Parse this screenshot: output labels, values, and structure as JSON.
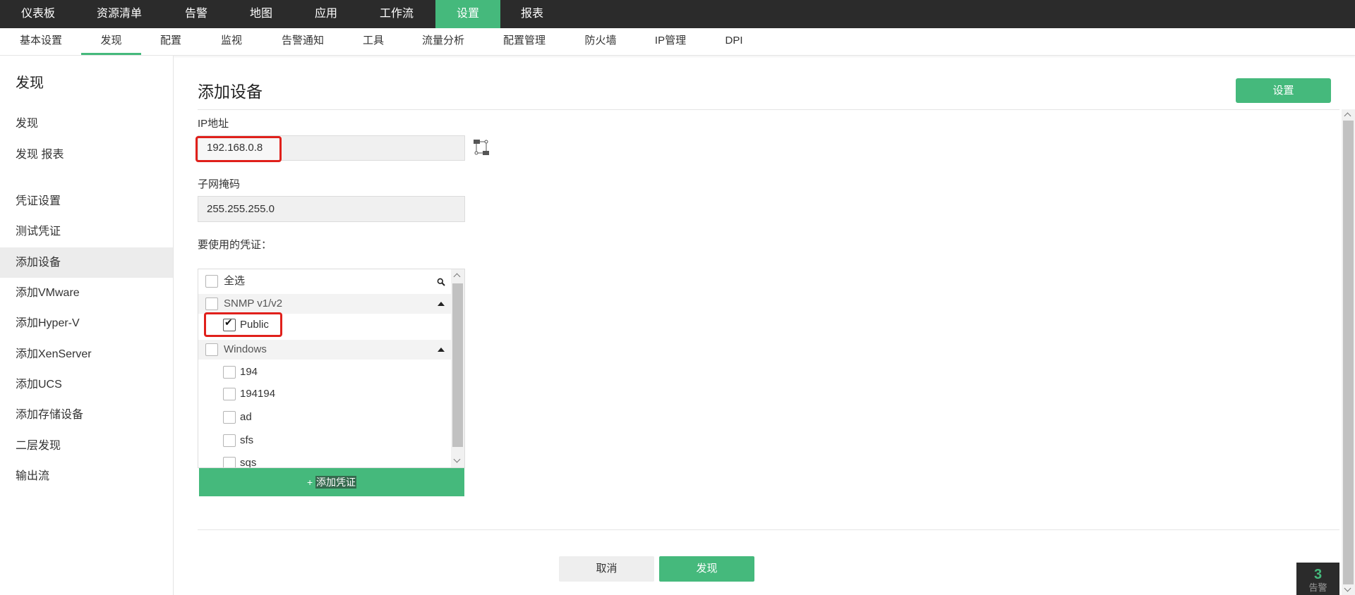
{
  "colors": {
    "accent": "#45b97c",
    "nav_bg": "#2b2b2b",
    "annotation_red": "#e0201b"
  },
  "icons": [
    "network-topology-icon",
    "search-icon",
    "caret-up-icon",
    "checkmark-icon",
    "chevron-up-icon",
    "chevron-down-icon"
  ],
  "top_nav": {
    "items": [
      {
        "label": "仪表板"
      },
      {
        "label": "资源清单"
      },
      {
        "label": "告警"
      },
      {
        "label": "地图"
      },
      {
        "label": "应用"
      },
      {
        "label": "工作流"
      },
      {
        "label": "设置",
        "active": true
      },
      {
        "label": "报表"
      }
    ]
  },
  "sub_nav": {
    "items": [
      {
        "label": "基本设置"
      },
      {
        "label": "发现",
        "active": true
      },
      {
        "label": "配置"
      },
      {
        "label": "监视"
      },
      {
        "label": "告警通知"
      },
      {
        "label": "工具"
      },
      {
        "label": "流量分析"
      },
      {
        "label": "配置管理"
      },
      {
        "label": "防火墙"
      },
      {
        "label": "IP管理"
      },
      {
        "label": "DPI"
      }
    ]
  },
  "sidebar": {
    "title": "发现",
    "items": [
      {
        "label": "发现"
      },
      {
        "label": "发现 报表"
      },
      {
        "label": "凭证设置"
      },
      {
        "label": "测试凭证"
      },
      {
        "label": "添加设备",
        "active": true
      },
      {
        "label": "添加VMware"
      },
      {
        "label": "添加Hyper-V"
      },
      {
        "label": "添加XenServer"
      },
      {
        "label": "添加UCS"
      },
      {
        "label": "添加存储设备"
      },
      {
        "label": "二层发现"
      },
      {
        "label": "输出流"
      }
    ]
  },
  "main": {
    "title": "添加设备",
    "settings_button": "设置",
    "ip_label": "IP地址",
    "ip_value": "192.168.0.8",
    "subnet_label": "子网掩码",
    "subnet_value": "255.255.255.0",
    "credentials_label": "要使用的凭证：",
    "credentials": {
      "select_all": {
        "label": "全选",
        "checked": false
      },
      "groups": [
        {
          "name": "SNMP v1/v2",
          "checked": false,
          "expanded": true,
          "items": [
            {
              "name": "Public",
              "checked": true
            }
          ]
        },
        {
          "name": "Windows",
          "checked": false,
          "expanded": true,
          "items": [
            {
              "name": "194",
              "checked": false
            },
            {
              "name": "194194",
              "checked": false
            },
            {
              "name": "ad",
              "checked": false
            },
            {
              "name": "sfs",
              "checked": false
            },
            {
              "name": "sqs",
              "checked": false
            }
          ]
        }
      ]
    },
    "add_credential_button": {
      "plus": "+",
      "label": "添加凭证"
    },
    "cancel_button": "取消",
    "discover_button": "发现"
  },
  "alarm_badge": {
    "count": "3",
    "label": "告警"
  }
}
